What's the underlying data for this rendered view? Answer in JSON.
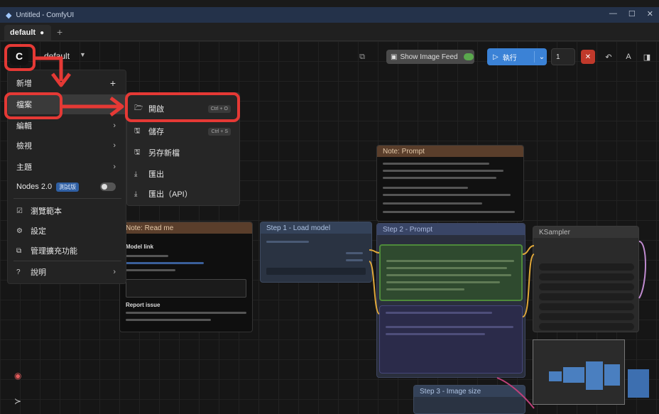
{
  "window": {
    "title": "Untitled - ComfyUI",
    "controls": [
      "—",
      "☐",
      "✕"
    ]
  },
  "tabs": [
    {
      "label": "default",
      "modified_marker": "●"
    }
  ],
  "new_tab_label": "+",
  "workflow": {
    "name": "default",
    "logo_glyph": "C"
  },
  "toolbar": {
    "show_image_feed_label": "Show Image Feed",
    "run_label": "執行",
    "batch_count": "1"
  },
  "menu": {
    "items": [
      {
        "label": "新增",
        "suffix": "+"
      },
      {
        "label": "檔案",
        "suffix": ""
      },
      {
        "label": "編輯",
        "suffix": "›"
      },
      {
        "label": "檢視",
        "suffix": "›"
      },
      {
        "label": "主題",
        "suffix": "›"
      }
    ],
    "nodes2": {
      "label": "Nodes 2.0",
      "badge": "測試版"
    },
    "extra_items": [
      {
        "label": "瀏覽範本",
        "icon": "☑"
      },
      {
        "label": "設定",
        "icon": "⚙"
      },
      {
        "label": "管理擴充功能",
        "icon": "⧉"
      },
      {
        "label": "說明",
        "icon": "?",
        "suffix": "›"
      }
    ]
  },
  "submenu": {
    "items": [
      {
        "label": "開啟",
        "icon": "🗁",
        "shortcut": "Ctrl + O"
      },
      {
        "label": "儲存",
        "icon": "🖫",
        "shortcut": "Ctrl + S"
      },
      {
        "label": "另存新檔",
        "icon": "🖫",
        "shortcut": ""
      },
      {
        "label": "匯出",
        "icon": "⤓",
        "shortcut": ""
      },
      {
        "label": "匯出（API）",
        "icon": "⤓",
        "shortcut": ""
      }
    ]
  },
  "nodes": {
    "note_title": "Note: Read me",
    "note_heading_1": "Model link",
    "note_heading_2": "Report issue",
    "loader_title": "Step 1 - Load model",
    "prompt_title": "Step 2 - Prompt",
    "notes_title": "Note: Prompt",
    "sampler_title": "KSampler",
    "image_title": "Step 3 - Image size"
  },
  "colors": {
    "accent_blue": "#3b82d6",
    "annotation_red": "#e53935",
    "stop_red": "#c0392b",
    "positive_green": "#4e8b3a"
  }
}
